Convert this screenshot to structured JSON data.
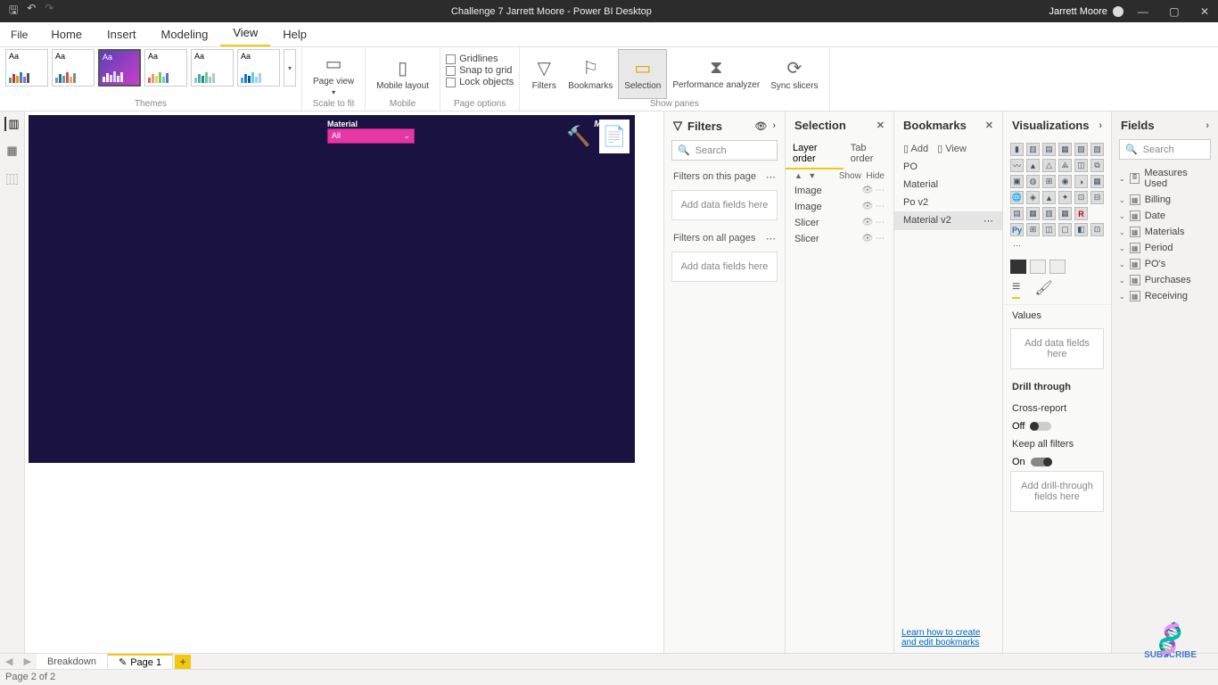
{
  "titlebar": {
    "title": "Challenge 7 Jarrett Moore - Power BI Desktop",
    "user": "Jarrett Moore"
  },
  "menu": {
    "file": "File",
    "items": [
      "Home",
      "Insert",
      "Modeling",
      "View",
      "Help"
    ],
    "active": "View"
  },
  "ribbon": {
    "groups": {
      "themes": "Themes",
      "scale": "Scale to fit",
      "mobile": "Mobile",
      "page_options": "Page options",
      "show_panes": "Show panes"
    },
    "page_view": "Page view",
    "mobile_layout": "Mobile layout",
    "gridlines": "Gridlines",
    "snap": "Snap to grid",
    "lock": "Lock objects",
    "filters": "Filters",
    "bookmarks": "Bookmarks",
    "selection": "Selection",
    "perf": "Performance analyzer",
    "sync": "Sync slicers"
  },
  "canvas": {
    "material_label": "Material",
    "slicer_title": "Material",
    "slicer_value": "All"
  },
  "filters": {
    "title": "Filters",
    "search": "Search",
    "on_page": "Filters on this page",
    "on_all": "Filters on all pages",
    "add": "Add data fields here"
  },
  "selection": {
    "title": "Selection",
    "layer": "Layer order",
    "tab": "Tab order",
    "show": "Show",
    "hide": "Hide",
    "items": [
      "Image",
      "Image",
      "Slicer",
      "Slicer"
    ]
  },
  "bookmarks": {
    "title": "Bookmarks",
    "add": "Add",
    "view": "View",
    "items": [
      "PO",
      "Material",
      "Po v2",
      "Material v2"
    ],
    "selected": "Material v2",
    "link": "Learn how to create and edit bookmarks"
  },
  "viz": {
    "title": "Visualizations",
    "values": "Values",
    "add_fields": "Add data fields here",
    "drill": "Drill through",
    "cross": "Cross-report",
    "off": "Off",
    "keep": "Keep all filters",
    "on": "On",
    "add_drill": "Add drill-through fields here"
  },
  "fields": {
    "title": "Fields",
    "search": "Search",
    "tables": [
      "Measures Used",
      "Billing",
      "Date",
      "Materials",
      "Period",
      "PO's",
      "Purchases",
      "Receiving"
    ]
  },
  "pages": {
    "tabs": [
      "Breakdown",
      "Page 1"
    ],
    "active": "Page 1"
  },
  "status": "Page 2 of 2",
  "subscribe": "SUBSCRIBE"
}
